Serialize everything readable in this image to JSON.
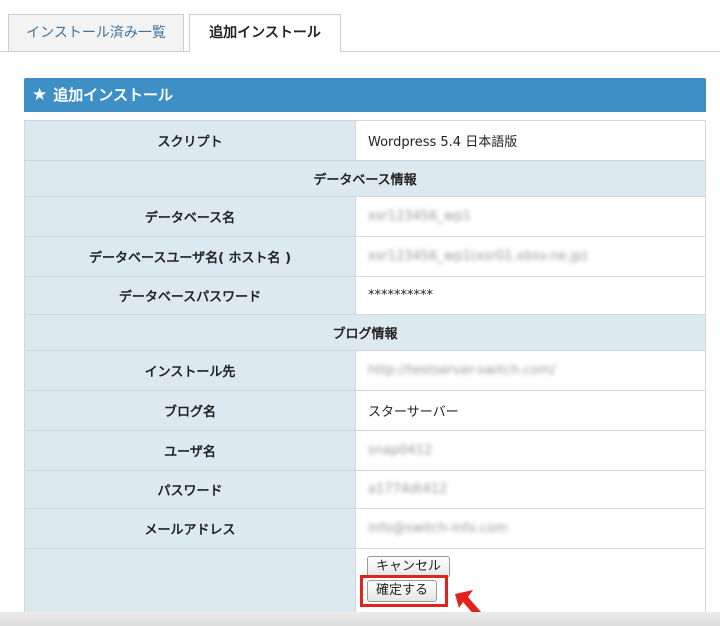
{
  "tabs": [
    {
      "label": "インストール済み一覧",
      "active": false
    },
    {
      "label": "追加インストール",
      "active": true
    }
  ],
  "panel": {
    "title": "追加インストール",
    "icon": "star-icon"
  },
  "rows": {
    "script": {
      "label": "スクリプト",
      "value": "Wordpress 5.4 日本語版"
    },
    "db_section": "データベース情報",
    "db_name": {
      "label": "データベース名",
      "value": "xsr123456_wp1"
    },
    "db_user": {
      "label": "データベースユーザ名( ホスト名 )",
      "value": "xsr123456_wp1(xsr01.xbsv.ne.jp)"
    },
    "db_pass": {
      "label": "データベースパスワード",
      "value": "**********"
    },
    "blog_section": "ブログ情報",
    "install_to": {
      "label": "インストール先",
      "value": "http://testserver-switch.com/"
    },
    "blog_name": {
      "label": "ブログ名",
      "value": "スターサーバー"
    },
    "user_name": {
      "label": "ユーザ名",
      "value": "snap0412"
    },
    "password": {
      "label": "パスワード",
      "value": "a1774dt412"
    },
    "email": {
      "label": "メールアドレス",
      "value": "info@switch-info.com"
    }
  },
  "buttons": {
    "cancel": "キャンセル",
    "confirm": "確定する"
  },
  "colors": {
    "header": "#3f8fc7",
    "label_bg": "#dde9f1",
    "highlight": "#e1231b"
  }
}
